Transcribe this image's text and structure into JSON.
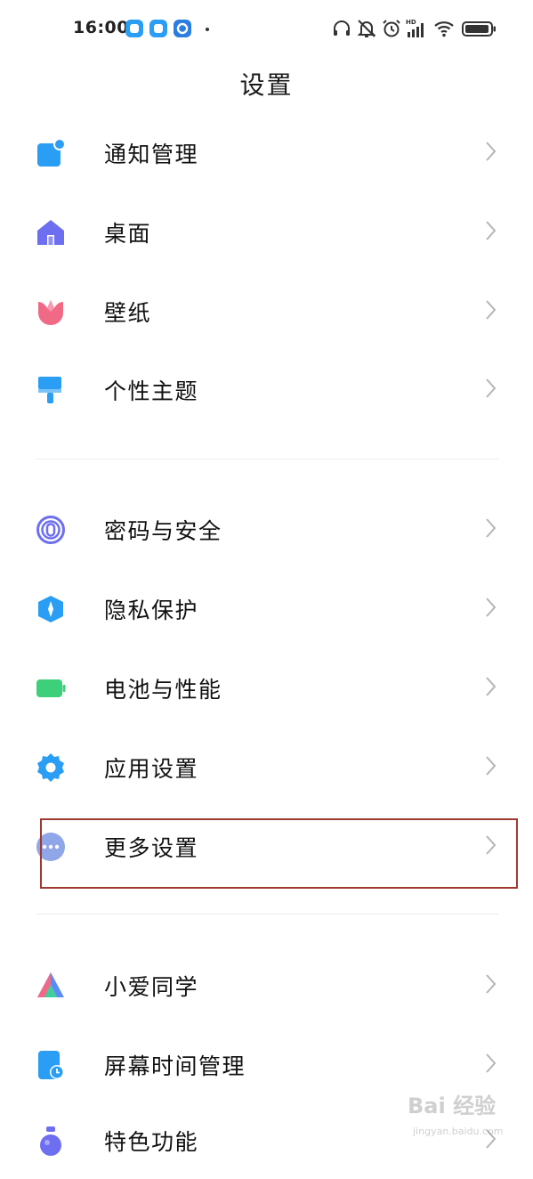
{
  "status_bar": {
    "time": "16:00",
    "notification_icons": [
      "app-notification-icon",
      "app-notification-icon",
      "browser-notification-icon"
    ],
    "system_icons": [
      "headset-icon",
      "mute-bell-icon",
      "alarm-icon",
      "hd-signal-icon",
      "wifi-icon",
      "battery-icon"
    ]
  },
  "header": {
    "title": "设置"
  },
  "groups": [
    {
      "items": [
        {
          "label": "通知管理",
          "icon": "notification-icon",
          "color": "#2a9df4"
        },
        {
          "label": "桌面",
          "icon": "home-icon",
          "color": "#6d6ff0"
        },
        {
          "label": "壁纸",
          "icon": "tulip-icon",
          "color": "#f06a86"
        },
        {
          "label": "个性主题",
          "icon": "paintbrush-icon",
          "color": "#2a9df4"
        }
      ]
    },
    {
      "items": [
        {
          "label": "密码与安全",
          "icon": "fingerprint-icon",
          "color": "#6d6ff0"
        },
        {
          "label": "隐私保护",
          "icon": "privacy-shield-icon",
          "color": "#2a9df4"
        },
        {
          "label": "电池与性能",
          "icon": "battery-icon",
          "color": "#3ecf7a"
        },
        {
          "label": "应用设置",
          "icon": "gear-icon",
          "color": "#2a9df4"
        },
        {
          "label": "更多设置",
          "icon": "more-dots-icon",
          "color": "#8fa6e8"
        }
      ]
    },
    {
      "items": [
        {
          "label": "小爱同学",
          "icon": "xiaoai-icon",
          "color": "#5b8cf5"
        },
        {
          "label": "屏幕时间管理",
          "icon": "screen-time-icon",
          "color": "#2a9df4"
        },
        {
          "label": "特色功能",
          "icon": "flask-icon",
          "color": "#6d6ff0"
        }
      ]
    }
  ],
  "highlight": {
    "target": "更多设置",
    "color": "#a03a30"
  },
  "watermark": {
    "text": "Bai 经验",
    "subtext": "jingyan.baidu.com"
  }
}
